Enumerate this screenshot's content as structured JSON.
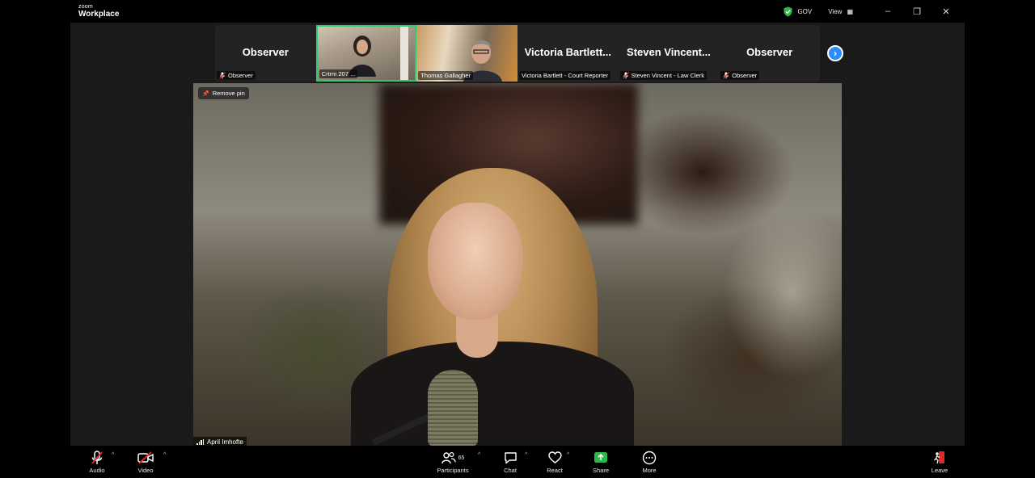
{
  "app": {
    "logo_small": "zoom",
    "logo_big": "Workplace",
    "badge": "GOV",
    "view_label": "View",
    "colors": {
      "accent": "#2d8cff",
      "active_border": "#2ecc71",
      "muted_red": "#e02828",
      "shield_green": "#2eb84a"
    }
  },
  "thumbnails": [
    {
      "name_big": "Observer",
      "label": "Observer",
      "muted": true,
      "video": false
    },
    {
      "name_big": "",
      "label": "Crtrm 207 ...",
      "muted": false,
      "video": true,
      "active": true
    },
    {
      "name_big": "",
      "label": "Thomas Gallagher",
      "muted": false,
      "video": true
    },
    {
      "name_big": "Victoria Bartlett...",
      "label": "Victoria Bartlett - Court Reporter",
      "muted": false,
      "video": false
    },
    {
      "name_big": "Steven Vincent...",
      "label": "Steven Vincent - Law Clerk",
      "muted": true,
      "video": false
    },
    {
      "name_big": "Observer",
      "label": "Observer",
      "muted": true,
      "video": false
    }
  ],
  "main": {
    "remove_pin": "Remove pin",
    "speaker": "April Imhofte"
  },
  "toolbar": {
    "audio": "Audio",
    "video": "Video",
    "participants": "Participants",
    "participants_count": "65",
    "chat": "Chat",
    "react": "React",
    "share": "Share",
    "more": "More",
    "leave": "Leave"
  }
}
